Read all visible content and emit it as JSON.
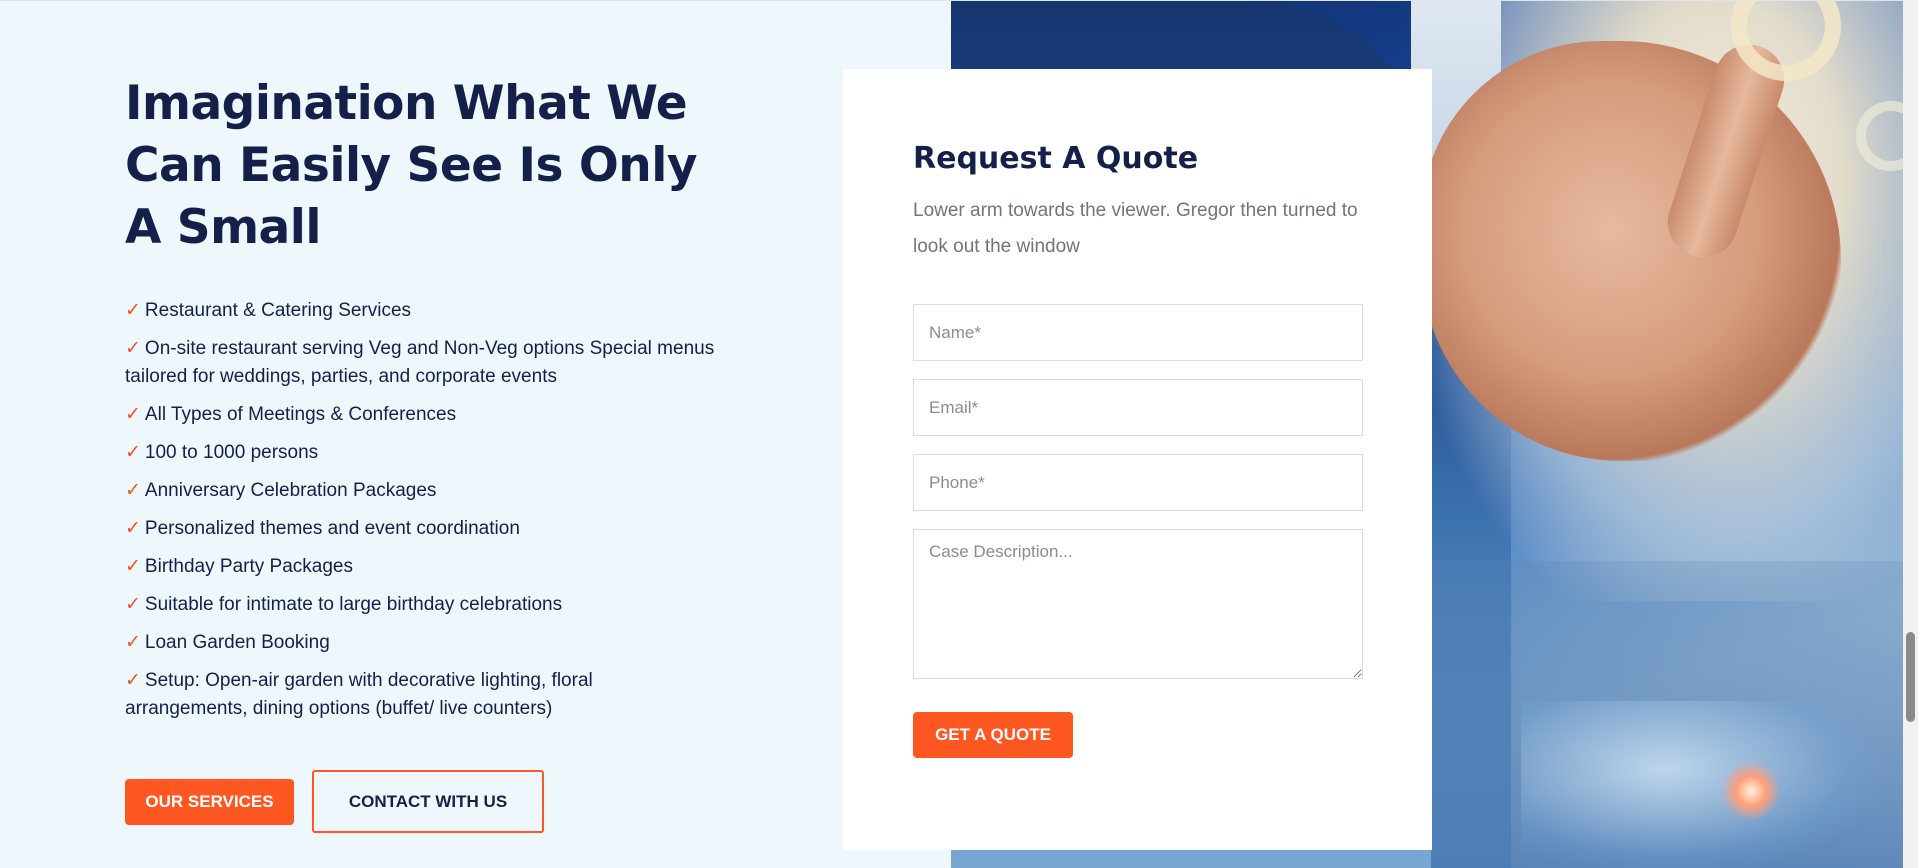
{
  "hero": {
    "headline": "Imagination What We Can Easily See Is Only A Small",
    "features": [
      "Restaurant & Catering Services",
      "On-site restaurant serving Veg and Non-Veg options Special menus tailored for weddings, parties, and corporate events",
      "All Types of Meetings & Conferences",
      "100 to 1000 persons",
      "Anniversary Celebration Packages",
      "Personalized themes and event coordination",
      "Birthday Party Packages",
      "Suitable for intimate to large birthday celebrations",
      "Loan Garden Booking",
      "Setup: Open-air garden with decorative lighting, floral arrangements, dining options (buffet/ live counters)"
    ],
    "check_glyph": "✓",
    "services_button": "Our Services",
    "contact_button": "Contact With Us"
  },
  "quote_form": {
    "title": "Request A Quote",
    "description": "Lower arm towards the viewer. Gregor then turned to look out the window",
    "name_placeholder": "Name*",
    "email_placeholder": "Email*",
    "phone_placeholder": "Phone*",
    "description_placeholder": "Case Description...",
    "submit_button": "Get A Quote"
  },
  "colors": {
    "accent": "#ff5722",
    "heading": "#14204a",
    "page_background": "#eef8fc"
  },
  "icons": {
    "feature_bullet": "check-icon"
  }
}
